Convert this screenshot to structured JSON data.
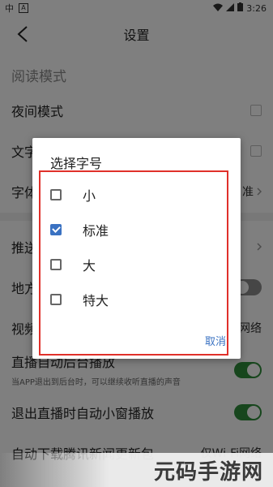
{
  "status_bar": {
    "left_icons": [
      "carrier-icon",
      "notification-icon"
    ],
    "left_text": "中",
    "badge": "A",
    "time": "3:26"
  },
  "header": {
    "title": "设置"
  },
  "sections": {
    "reading_mode": "阅读模式",
    "night_mode": "夜间模式",
    "text_row": "文字",
    "font_row": "字体",
    "font_row_value": "准",
    "push_row": "推送",
    "local_row": "地方",
    "video_row": "视频",
    "video_row_value": "网络",
    "live_bg": "直播自动后台播放",
    "live_bg_sub": "当APP退出到后台时，可以继续收听直播的声音",
    "live_mini": "退出直播时自动小窗播放",
    "auto_download": "自动下载腾讯新闻更新包",
    "auto_download_value": "仅Wi-Fi网络"
  },
  "dialog": {
    "title": "选择字号",
    "options": [
      {
        "label": "小",
        "checked": false
      },
      {
        "label": "标准",
        "checked": true
      },
      {
        "label": "大",
        "checked": false
      },
      {
        "label": "特大",
        "checked": false
      }
    ],
    "cancel": "取消"
  },
  "watermark": "元码手游网",
  "colors": {
    "accent": "#3a72c2",
    "toggle_on": "#2e8c3a",
    "highlight_border": "#e0302a"
  }
}
